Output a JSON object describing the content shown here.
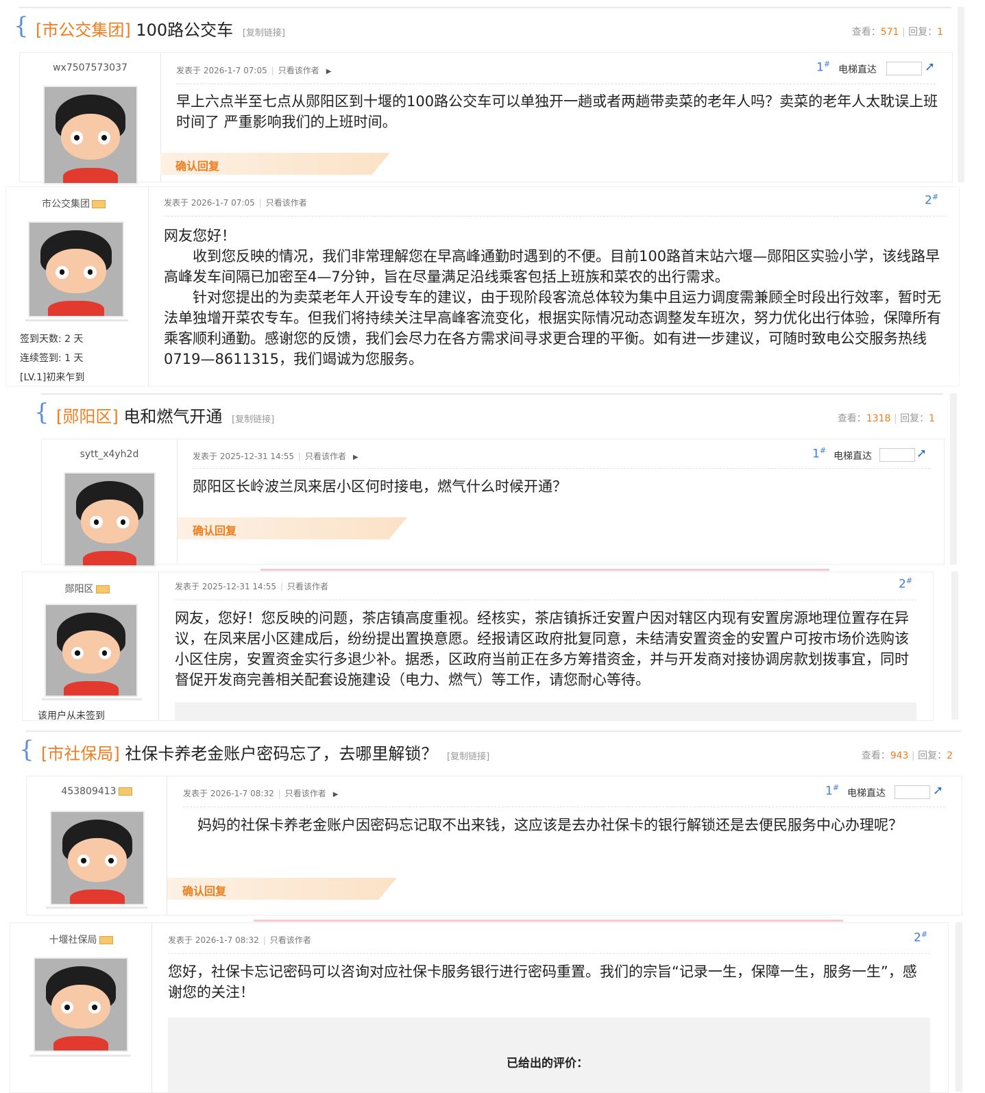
{
  "common": {
    "copy_link": "[复制链接]",
    "posted_prefix": "发表于",
    "only_author": "只看该作者",
    "elevator": "电梯直达",
    "confirm_reply": "确认回复",
    "views_label": "查看：",
    "replies_label": "回复：",
    "floor1": "1",
    "floor2": "2",
    "floor_mark": "#"
  },
  "threads": [
    {
      "tag": "[市公交集团]",
      "title": "100路公交车",
      "views": "571",
      "replies": "1",
      "q": {
        "user": "wx7507573037",
        "time": "2026-1-7 07:05",
        "text": "早上六点半至七点从郧阳区到十堰的100路公交车可以单独开一趟或者两趟带卖菜的老年人吗？卖菜的老年人太耽误上班时间了 严重影响我们的上班时间。"
      },
      "a": {
        "user": "市公交集团",
        "time": "2026-1-7 07:05",
        "side1": "签到天数: 2 天",
        "side2": "连续签到: 1 天",
        "side3": "[LV.1]初来乍到",
        "p1": "网友您好！",
        "p2": "　　收到您反映的情况，我们非常理解您在早高峰通勤时遇到的不便。目前100路首末站六堰—郧阳区实验小学，该线路早高峰发车间隔已加密至4—7分钟，旨在尽量满足沿线乘客包括上班族和菜农的出行需求。",
        "p3": "　　针对您提出的为卖菜老年人开设专车的建议，由于现阶段客流总体较为集中且运力调度需兼顾全时段出行效率，暂时无法单独增开菜农专车。但我们将持续关注早高峰客流变化，根据实际情况动态调整发车班次，努力优化出行体验，保障所有乘客顺利通勤。感谢您的反馈，我们会尽力在各方需求间寻求更合理的平衡。如有进一步建议，可随时致电公交服务热线0719—8611315，我们竭诚为您服务。"
      }
    },
    {
      "tag": "[郧阳区]",
      "title": "电和燃气开通",
      "views": "1318",
      "replies": "1",
      "q": {
        "user": "sytt_x4yh2d",
        "time": "2025-12-31 14:55",
        "text": "郧阳区长岭波兰凤来居小区何时接电，燃气什么时候开通？"
      },
      "a": {
        "user": "郧阳区",
        "time": "2025-12-31 14:55",
        "side1": "该用户从未签到",
        "text": "网友，您好！您反映的问题，茶店镇高度重视。经核实，茶店镇拆迁安置户因对辖区内现有安置房源地理位置存在异议，在凤来居小区建成后，纷纷提出置换意愿。经报请区政府批复同意，未结清安置资金的安置户可按市场价选购该小区住房，安置资金实行多退少补。据悉，区政府当前正在多方筹措资金，并与开发商对接协调房款划拨事宜，同时督促开发商完善相关配套设施建设（电力、燃气）等工作，请您耐心等待。"
      }
    },
    {
      "tag": "[市社保局]",
      "title": "社保卡养老金账户密码忘了，去哪里解锁？",
      "views": "943",
      "replies": "2",
      "q": {
        "user": "453809413",
        "time": "2026-1-7 08:32",
        "text": "　妈妈的社保卡养老金账户因密码忘记取不出来钱，这应该是去办社保卡的银行解锁还是去便民服务中心办理呢？"
      },
      "a": {
        "user": "十堰社保局",
        "time": "2026-1-7 08:32",
        "text": "您好，社保卡忘记密码可以咨询对应社保卡服务银行进行密码重置。我们的宗旨“记录一生，保障一生，服务一生”，感谢您的关注！",
        "rating": "已给出的评价："
      }
    }
  ],
  "colors": {
    "accent": "#ef7d1e",
    "link": "#3b7dd8",
    "brace": "#5b8fd6"
  }
}
